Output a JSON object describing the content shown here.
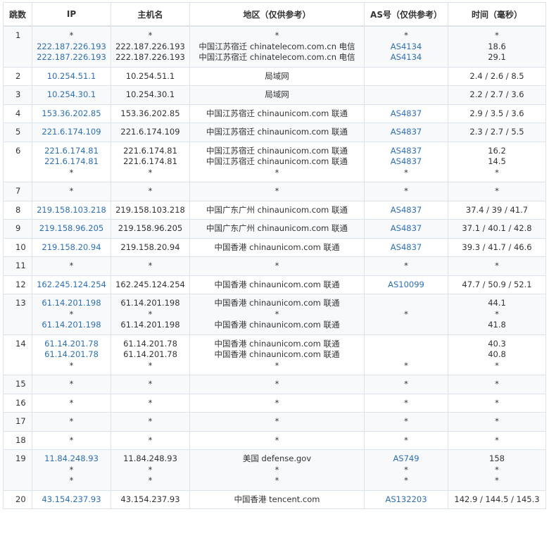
{
  "headers": {
    "hop": "跳数",
    "ip": "IP",
    "host": "主机名",
    "region": "地区（仅供参考）",
    "as": "AS号（仅供参考）",
    "time": "时间（毫秒）"
  },
  "colors": {
    "link": "#2f6fb3",
    "border": "#dde3ea",
    "stripe": "#f7f9fb"
  },
  "rows": [
    {
      "hop": "1",
      "ip": [
        "*",
        "222.187.226.193",
        "222.187.226.193"
      ],
      "host": [
        "*",
        "222.187.226.193",
        "222.187.226.193"
      ],
      "region": [
        "*",
        "中国江苏宿迁 chinatelecom.com.cn 电信",
        "中国江苏宿迁 chinatelecom.com.cn 电信"
      ],
      "as": [
        "*",
        "AS4134",
        "AS4134"
      ],
      "time": [
        "*",
        "18.6",
        "29.1"
      ]
    },
    {
      "hop": "2",
      "ip": [
        "10.254.51.1"
      ],
      "host": [
        "10.254.51.1"
      ],
      "region": [
        "局域网"
      ],
      "as": [
        ""
      ],
      "time": [
        "2.4 / 2.6 / 8.5"
      ]
    },
    {
      "hop": "3",
      "ip": [
        "10.254.30.1"
      ],
      "host": [
        "10.254.30.1"
      ],
      "region": [
        "局域网"
      ],
      "as": [
        ""
      ],
      "time": [
        "2.2 / 2.7 / 3.6"
      ]
    },
    {
      "hop": "4",
      "ip": [
        "153.36.202.85"
      ],
      "host": [
        "153.36.202.85"
      ],
      "region": [
        "中国江苏宿迁 chinaunicom.com 联通"
      ],
      "as": [
        "AS4837"
      ],
      "time": [
        "2.9 / 3.5 / 3.6"
      ]
    },
    {
      "hop": "5",
      "ip": [
        "221.6.174.109"
      ],
      "host": [
        "221.6.174.109"
      ],
      "region": [
        "中国江苏宿迁 chinaunicom.com 联通"
      ],
      "as": [
        "AS4837"
      ],
      "time": [
        "2.3 / 2.7 / 5.5"
      ]
    },
    {
      "hop": "6",
      "ip": [
        "221.6.174.81",
        "221.6.174.81",
        "*"
      ],
      "host": [
        "221.6.174.81",
        "221.6.174.81",
        "*"
      ],
      "region": [
        "中国江苏宿迁 chinaunicom.com 联通",
        "中国江苏宿迁 chinaunicom.com 联通",
        "*"
      ],
      "as": [
        "AS4837",
        "AS4837",
        "*"
      ],
      "time": [
        "16.2",
        "14.5",
        "*"
      ]
    },
    {
      "hop": "7",
      "ip": [
        "*"
      ],
      "host": [
        "*"
      ],
      "region": [
        "*"
      ],
      "as": [
        "*"
      ],
      "time": [
        "*"
      ]
    },
    {
      "hop": "8",
      "ip": [
        "219.158.103.218"
      ],
      "host": [
        "219.158.103.218"
      ],
      "region": [
        "中国广东广州 chinaunicom.com 联通"
      ],
      "as": [
        "AS4837"
      ],
      "time": [
        "37.4 / 39 / 41.7"
      ]
    },
    {
      "hop": "9",
      "ip": [
        "219.158.96.205"
      ],
      "host": [
        "219.158.96.205"
      ],
      "region": [
        "中国广东广州 chinaunicom.com 联通"
      ],
      "as": [
        "AS4837"
      ],
      "time": [
        "37.1 / 40.1 / 42.8"
      ]
    },
    {
      "hop": "10",
      "ip": [
        "219.158.20.94"
      ],
      "host": [
        "219.158.20.94"
      ],
      "region": [
        "中国香港 chinaunicom.com 联通"
      ],
      "as": [
        "AS4837"
      ],
      "time": [
        "39.3 / 41.7 / 46.6"
      ]
    },
    {
      "hop": "11",
      "ip": [
        "*"
      ],
      "host": [
        "*"
      ],
      "region": [
        "*"
      ],
      "as": [
        "*"
      ],
      "time": [
        "*"
      ]
    },
    {
      "hop": "12",
      "ip": [
        "162.245.124.254"
      ],
      "host": [
        "162.245.124.254"
      ],
      "region": [
        "中国香港 chinaunicom.com 联通"
      ],
      "as": [
        "AS10099"
      ],
      "time": [
        "47.7 / 50.9 / 52.1"
      ]
    },
    {
      "hop": "13",
      "ip": [
        "61.14.201.198",
        "*",
        "61.14.201.198"
      ],
      "host": [
        "61.14.201.198",
        "*",
        "61.14.201.198"
      ],
      "region": [
        "中国香港 chinaunicom.com 联通",
        "*",
        "中国香港 chinaunicom.com 联通"
      ],
      "as": [
        "",
        "*",
        ""
      ],
      "time": [
        "44.1",
        "*",
        "41.8"
      ]
    },
    {
      "hop": "14",
      "ip": [
        "61.14.201.78",
        "61.14.201.78",
        "*"
      ],
      "host": [
        "61.14.201.78",
        "61.14.201.78",
        "*"
      ],
      "region": [
        "中国香港 chinaunicom.com 联通",
        "中国香港 chinaunicom.com 联通",
        "*"
      ],
      "as": [
        "",
        "",
        "*"
      ],
      "time": [
        "40.3",
        "40.8",
        "*"
      ]
    },
    {
      "hop": "15",
      "ip": [
        "*"
      ],
      "host": [
        "*"
      ],
      "region": [
        "*"
      ],
      "as": [
        "*"
      ],
      "time": [
        "*"
      ]
    },
    {
      "hop": "16",
      "ip": [
        "*"
      ],
      "host": [
        "*"
      ],
      "region": [
        "*"
      ],
      "as": [
        "*"
      ],
      "time": [
        "*"
      ]
    },
    {
      "hop": "17",
      "ip": [
        "*"
      ],
      "host": [
        "*"
      ],
      "region": [
        "*"
      ],
      "as": [
        "*"
      ],
      "time": [
        "*"
      ]
    },
    {
      "hop": "18",
      "ip": [
        "*"
      ],
      "host": [
        "*"
      ],
      "region": [
        "*"
      ],
      "as": [
        "*"
      ],
      "time": [
        "*"
      ]
    },
    {
      "hop": "19",
      "ip": [
        "11.84.248.93",
        "*",
        "*"
      ],
      "host": [
        "11.84.248.93",
        "*",
        "*"
      ],
      "region": [
        "美国 defense.gov",
        "*",
        "*"
      ],
      "as": [
        "AS749",
        "*",
        "*"
      ],
      "time": [
        "158",
        "*",
        "*"
      ]
    },
    {
      "hop": "20",
      "ip": [
        "43.154.237.93"
      ],
      "host": [
        "43.154.237.93"
      ],
      "region": [
        "中国香港 tencent.com"
      ],
      "as": [
        "AS132203"
      ],
      "time": [
        "142.9 / 144.5 / 145.3"
      ]
    }
  ]
}
